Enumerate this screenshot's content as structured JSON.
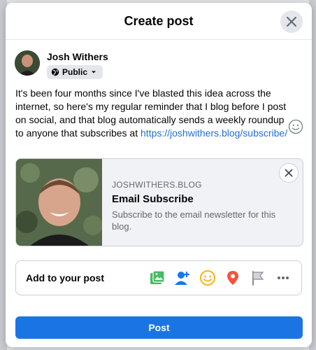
{
  "dialog": {
    "title": "Create post"
  },
  "user": {
    "name": "Josh Withers",
    "privacy_label": "Public"
  },
  "post": {
    "text": "It's been four months since I've blasted this idea across the internet, so here's my regular reminder that I blog before I post on social, and that blog automatically sends a weekly roundup to anyone that subscribes at ",
    "link_text": "https://joshwithers.blog/subscribe/"
  },
  "link_preview": {
    "domain": "JOSHWITHERS.BLOG",
    "title": "Email Subscribe",
    "description": "Subscribe to the email newsletter for this blog."
  },
  "add_to_post": {
    "label": "Add to your post",
    "icons": [
      "photo-video-icon",
      "tag-people-icon",
      "feeling-icon",
      "check-in-icon",
      "flag-icon",
      "more-icon"
    ]
  },
  "actions": {
    "post_label": "Post"
  },
  "colors": {
    "accent": "#1b74e4",
    "link": "#216fdb",
    "photo": "#45bd62",
    "tag": "#1877f2",
    "feeling": "#f7b928",
    "checkin": "#f5533d"
  }
}
